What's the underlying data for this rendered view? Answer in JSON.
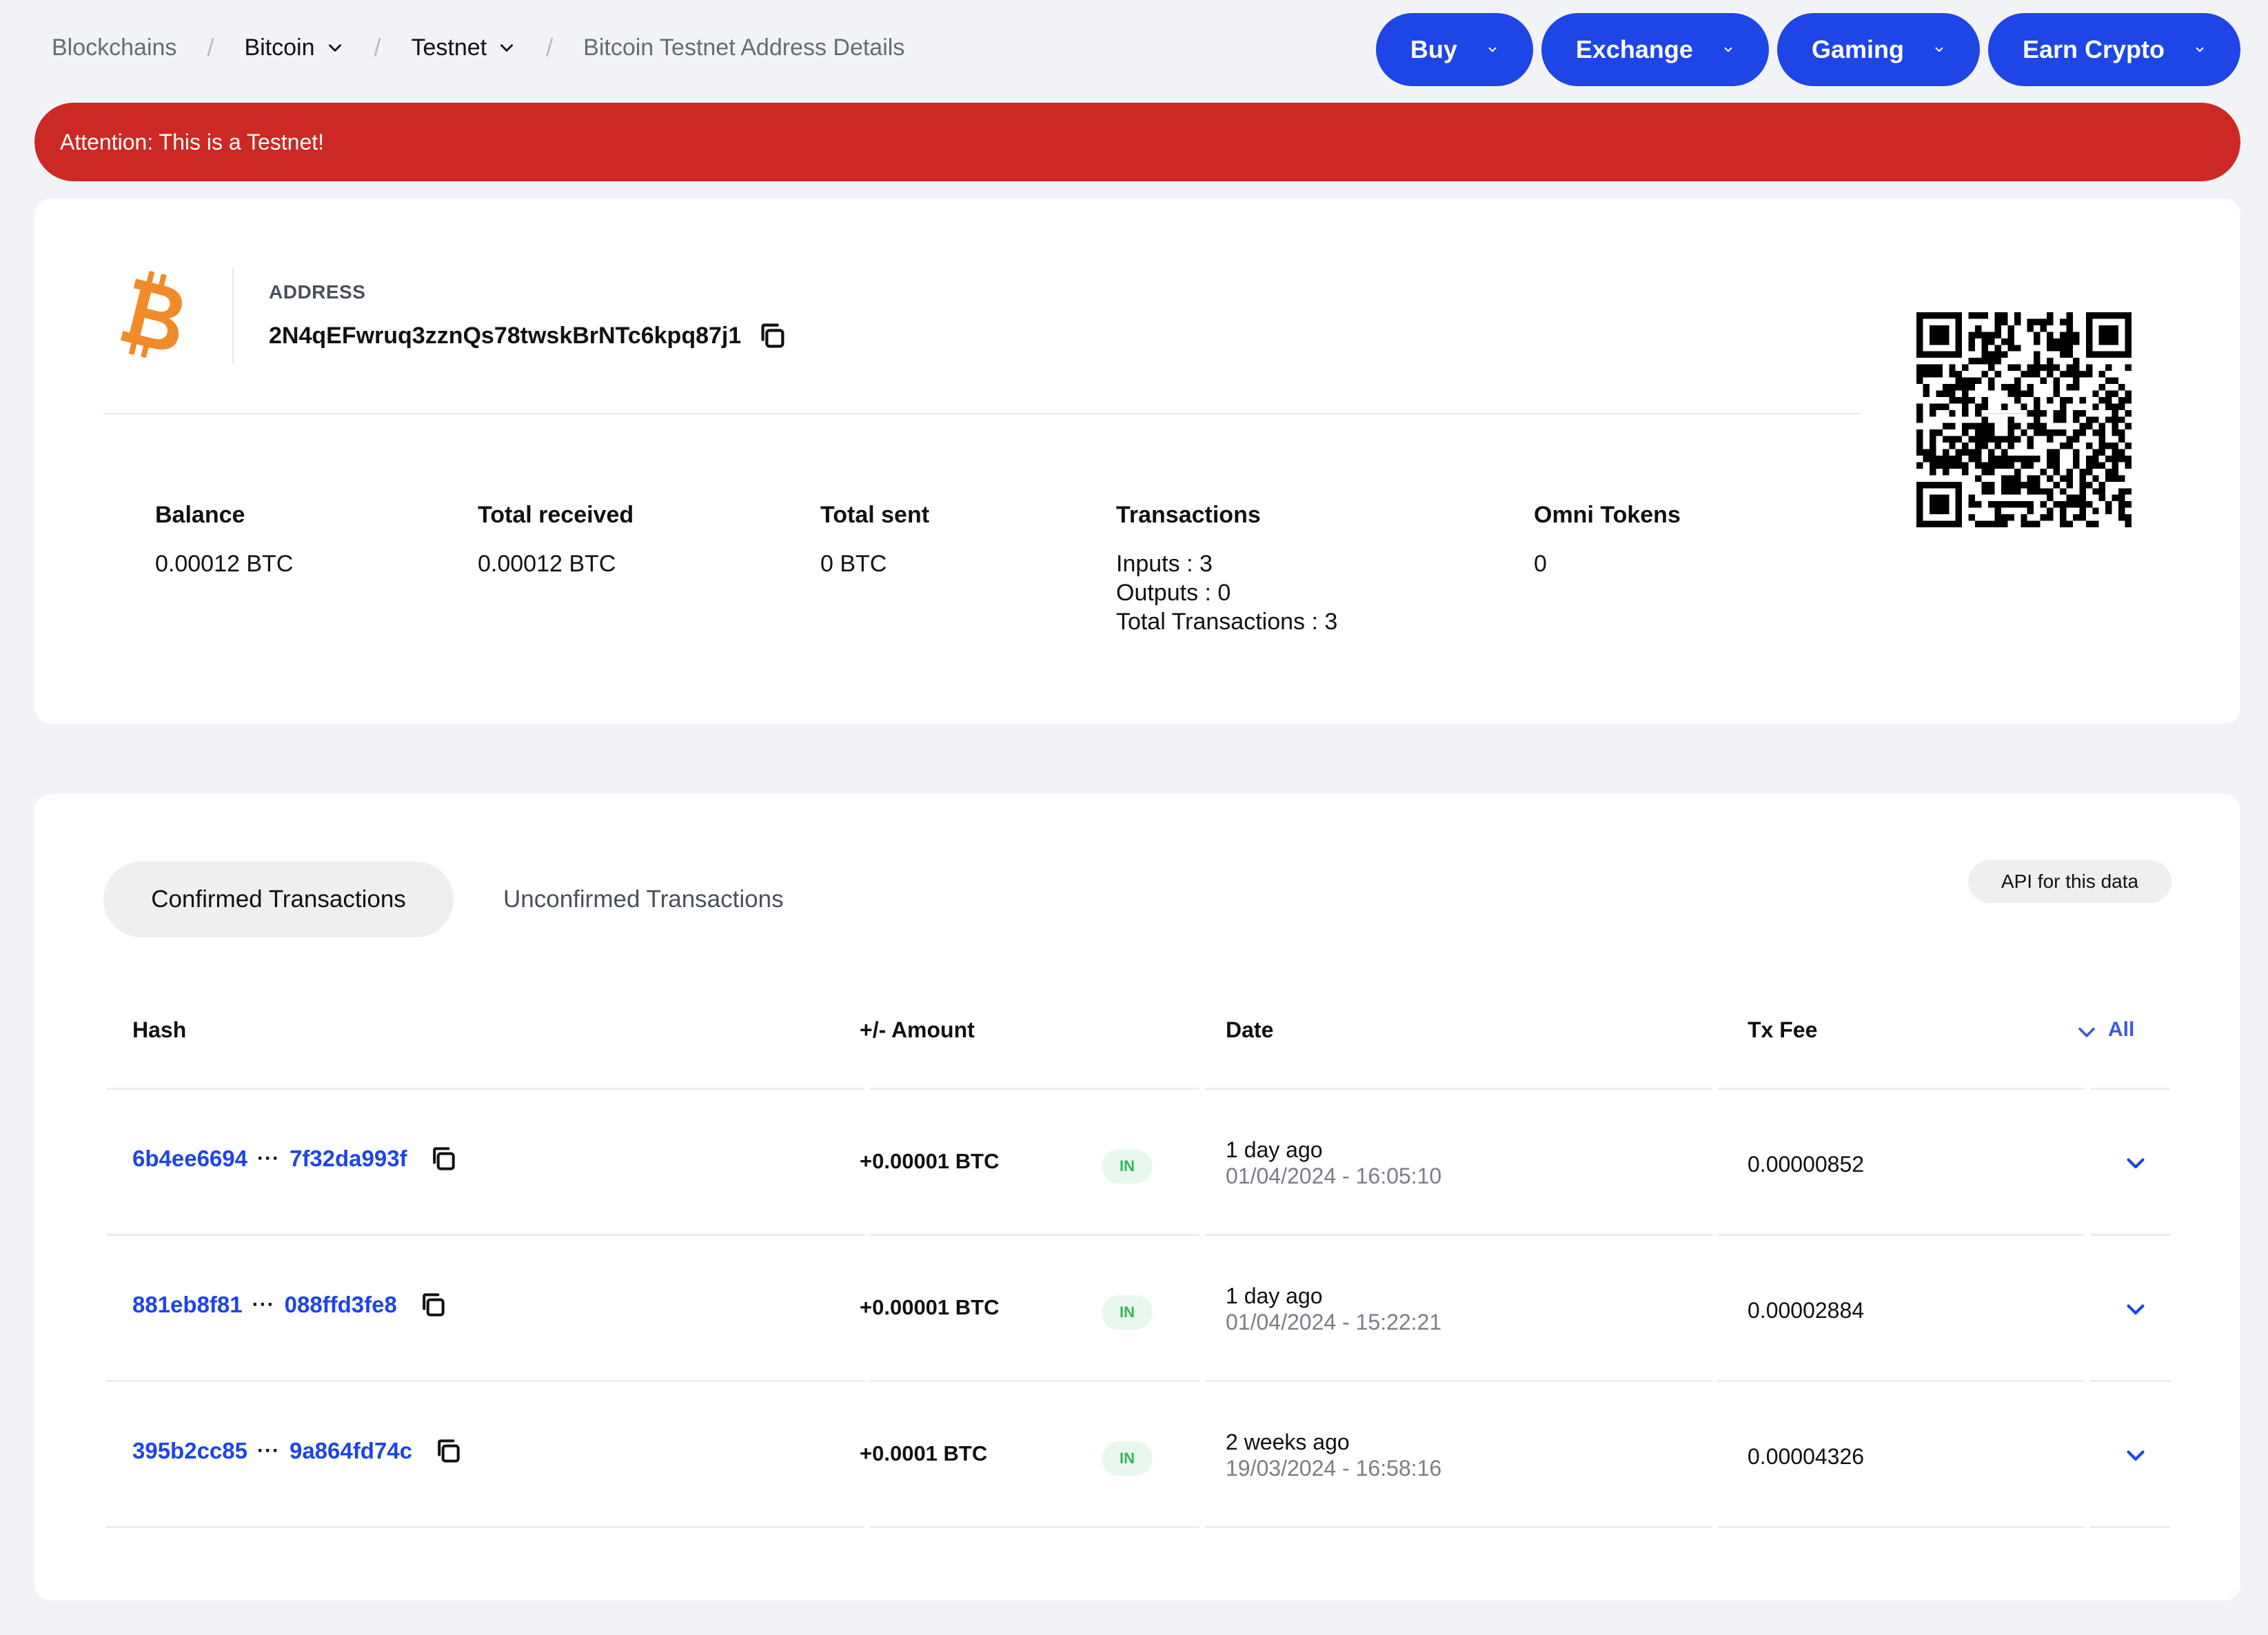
{
  "breadcrumb": {
    "items": [
      "Blockchains",
      "Bitcoin",
      "Testnet",
      "Bitcoin Testnet Address Details"
    ],
    "separator": "/"
  },
  "nav": {
    "buttons": [
      "Buy",
      "Exchange",
      "Gaming",
      "Earn Crypto"
    ]
  },
  "alert": {
    "text": "Attention: This is a Testnet!"
  },
  "address": {
    "label": "ADDRESS",
    "value": "2N4qEFwruq3zznQs78twskBrNTc6kpq87j1"
  },
  "stats": {
    "balance": {
      "label": "Balance",
      "value": "0.00012 BTC"
    },
    "total_received": {
      "label": "Total received",
      "value": "0.00012 BTC"
    },
    "total_sent": {
      "label": "Total sent",
      "value": "0 BTC"
    },
    "transactions": {
      "label": "Transactions",
      "inputs": "Inputs : 3",
      "outputs": "Outputs : 0",
      "total": "Total Transactions : 3"
    },
    "omni_tokens": {
      "label": "Omni Tokens",
      "value": "0"
    }
  },
  "tabs": {
    "confirmed": "Confirmed Transactions",
    "unconfirmed": "Unconfirmed Transactions",
    "api": "API for this data"
  },
  "table": {
    "headers": {
      "hash": "Hash",
      "amount": "+/- Amount",
      "date": "Date",
      "fee": "Tx Fee",
      "all": "All"
    },
    "rows": [
      {
        "hash_start": "6b4ee6694",
        "dots": "···",
        "hash_end": "7f32da993f",
        "amount": "+0.00001 BTC",
        "direction": "IN",
        "date_relative": "1 day ago",
        "date_absolute": "01/04/2024 - 16:05:10",
        "fee": "0.00000852"
      },
      {
        "hash_start": "881eb8f81",
        "dots": "···",
        "hash_end": "088ffd3fe8",
        "amount": "+0.00001 BTC",
        "direction": "IN",
        "date_relative": "1 day ago",
        "date_absolute": "01/04/2024 - 15:22:21",
        "fee": "0.00002884"
      },
      {
        "hash_start": "395b2cc85",
        "dots": "···",
        "hash_end": "9a864fd74c",
        "amount": "+0.0001 BTC",
        "direction": "IN",
        "date_relative": "2 weeks ago",
        "date_absolute": "19/03/2024 - 16:58:16",
        "fee": "0.00004326"
      }
    ]
  },
  "colors": {
    "accent": "#1e45e6",
    "alert": "#cc2924",
    "bitcoin": "#f08b2a",
    "in_badge_text": "#34b65e",
    "in_badge_bg": "#e9f8ee"
  },
  "icons": [
    "bitcoin-logo-icon",
    "copy-icon",
    "chevron-down-icon",
    "qr-code"
  ]
}
